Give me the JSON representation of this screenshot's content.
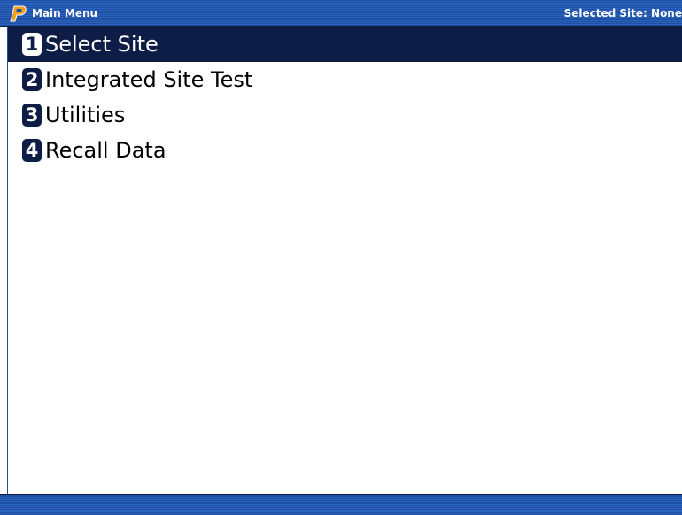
{
  "title_bar": {
    "title": "Main Menu",
    "selected_site_text": "Selected Site: None"
  },
  "menu": {
    "items": [
      {
        "number": "1",
        "label": "Select Site",
        "selected": true
      },
      {
        "number": "2",
        "label": "Integrated Site Test",
        "selected": false
      },
      {
        "number": "3",
        "label": "Utilities",
        "selected": false
      },
      {
        "number": "4",
        "label": "Recall Data",
        "selected": false
      }
    ]
  },
  "colors": {
    "title_bar": "#2a64c0",
    "selection": "#0d1d45",
    "logo": "#f0a020"
  }
}
